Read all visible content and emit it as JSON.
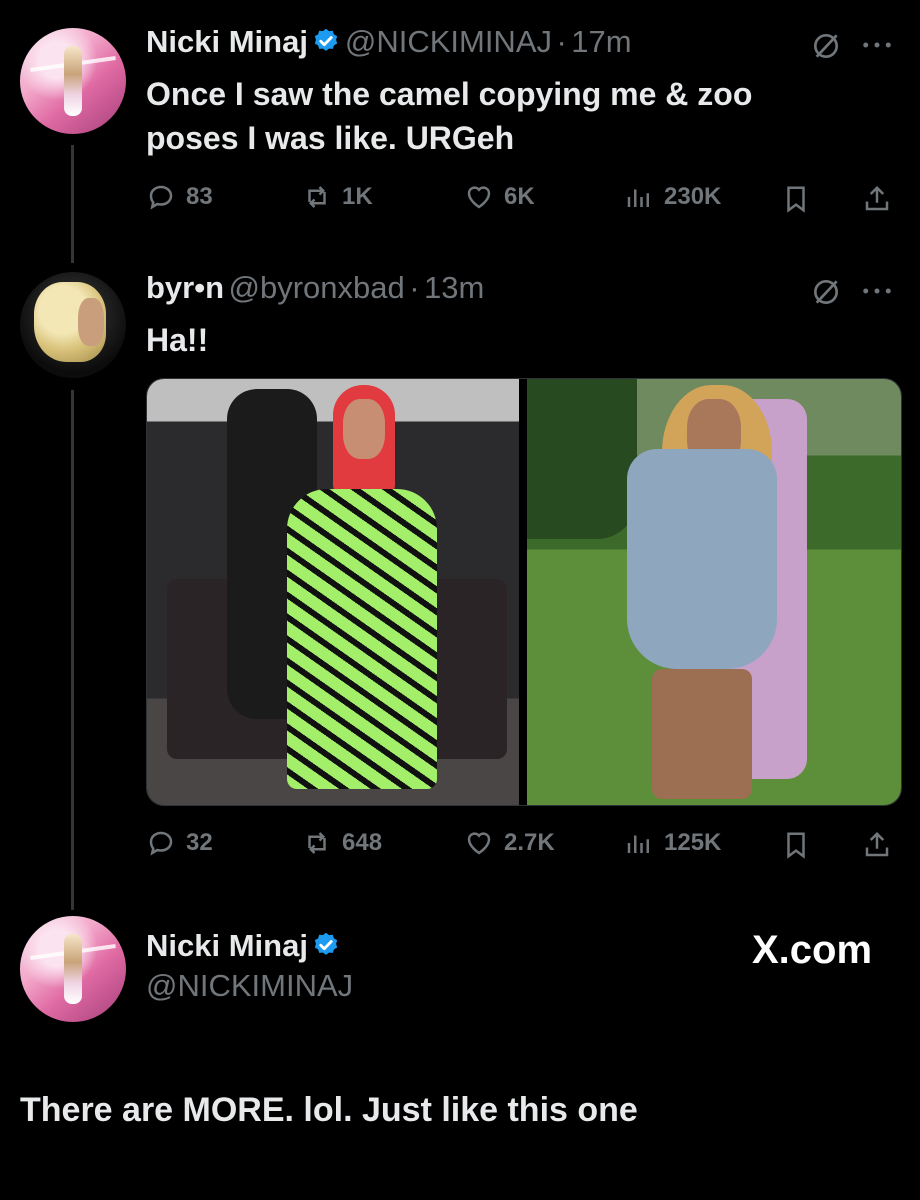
{
  "tweet1": {
    "name": "Nicki Minaj",
    "handle": "@NICKIMINAJ",
    "time": "17m",
    "text": "Once I saw the camel copying me & zoo poses I was like. URGeh",
    "text_line1": "Once I saw the camel copying me & zoo",
    "text_line2": "poses I was like. URGeh",
    "replies": "83",
    "reposts": "1K",
    "likes": "6K",
    "views": "230K"
  },
  "tweet2": {
    "name": "byr•n",
    "handle": "@byronxbad",
    "time": "13m",
    "text": "Ha!!",
    "replies": "32",
    "reposts": "648",
    "likes": "2.7K",
    "views": "125K"
  },
  "tweet3": {
    "name": "Nicki Minaj",
    "handle": "@NICKIMINAJ",
    "site": "X.com",
    "text": "There are MORE. lol. Just like this one"
  },
  "separator": "·",
  "colors": {
    "background": "#000000",
    "text": "#e7e9ea",
    "muted": "#71767b",
    "verified": "#1d9bf0"
  }
}
